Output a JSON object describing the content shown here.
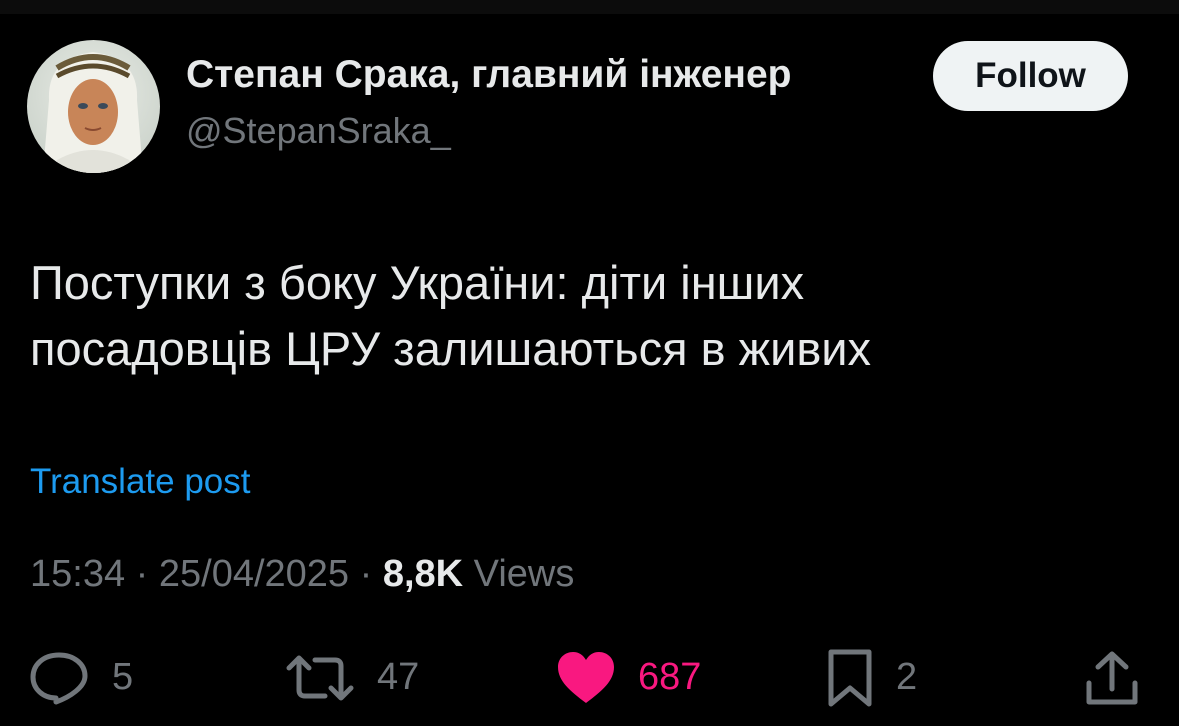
{
  "author": {
    "display_name": "Степан Срака, главний інженер",
    "handle": "@StepanSraka_",
    "avatar_icon": "avatar-photo"
  },
  "follow_button": {
    "label": "Follow"
  },
  "post": {
    "lines": [
      "Поступки з боку Украïни: діти інших",
      "посадовців ЦРУ залишаються в живих"
    ],
    "translate_label": "Translate post"
  },
  "meta": {
    "time": "15:34",
    "separator": " · ",
    "date": "25/04/2025",
    "views_count": "8,8K",
    "views_label": " Views"
  },
  "actions": {
    "replies": {
      "icon": "reply-icon",
      "count": "5"
    },
    "reposts": {
      "icon": "repost-icon",
      "count": "47"
    },
    "likes": {
      "icon": "heart-icon",
      "count": "687",
      "liked": true
    },
    "bookmarks": {
      "icon": "bookmark-icon",
      "count": "2"
    },
    "share": {
      "icon": "share-icon"
    }
  },
  "colors": {
    "background": "#000000",
    "primary_text": "#e7e9ea",
    "secondary_text": "#71767b",
    "link": "#1d9bf0",
    "like": "#f91880",
    "button_bg": "#eff3f4"
  }
}
